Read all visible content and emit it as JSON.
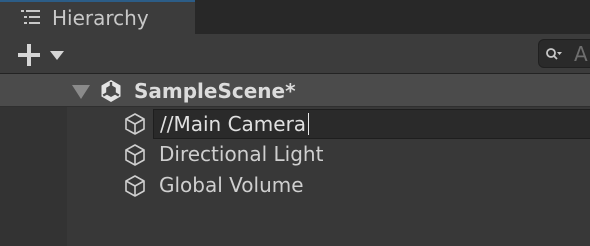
{
  "tab": {
    "title": "Hierarchy",
    "icon": "hierarchy-list-icon"
  },
  "toolbar": {
    "add_icon": "plus-icon",
    "dropdown_icon": "chevron-down-icon",
    "search": {
      "icon": "search-icon",
      "placeholder": "A"
    }
  },
  "tree": {
    "scene": {
      "label": "SampleScene*",
      "icon": "unity-scene-icon",
      "expanded": true
    },
    "items": [
      {
        "label": "//Main Camera",
        "icon": "cube-icon",
        "editing": true
      },
      {
        "label": "Directional Light",
        "icon": "cube-icon",
        "editing": false
      },
      {
        "label": "Global Volume",
        "icon": "cube-icon",
        "editing": false
      }
    ]
  },
  "colors": {
    "panel_background": "#383838",
    "tab_accent": "#2c5d87",
    "scene_row_background": "#4b4b4b",
    "text": "#cfcfcf"
  }
}
